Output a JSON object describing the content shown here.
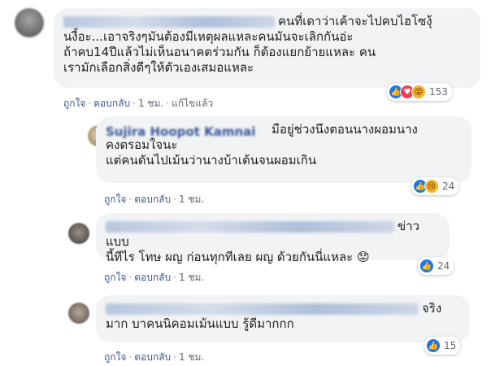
{
  "comments": [
    {
      "text": "คนที่เดาว่าเค้าจะไปคบไฮโซงุ้นงี้อะ...เอาจริงๆมันต้องมีเหตุผลแหละคนมันจะเลิกกันอ่ะ\nถ้าคบ14ปีแล้วไม่เห็นอนาคตร่วมกัน ก็ต้องแยกย้ายแหละ คน\nเรามักเลือกสิ่งดีๆให้ตัวเองเสมอแหละ",
      "actions": {
        "like": "ถูกใจ",
        "reply": "ตอบกลับ",
        "time": "1 ชม.",
        "edited": "แก้ไขแล้ว"
      },
      "reactions": {
        "icons": [
          "like-icon",
          "haha-icon"
        ],
        "count": "153"
      }
    },
    {
      "name": "Sujira Hoopot Kamnai",
      "text": "มือยู่ช่วงนึงตอนนางผอมนาง\nคงตรอมใจนะ\nแต่คนดันไปเม้นว่านางบ้าเต้นจนผอมเกิน",
      "actions": {
        "like": "ถูกใจ",
        "reply": "ตอบกลับ",
        "time": "1 ชม."
      },
      "reactions": {
        "icons": [
          "like-icon",
          "sad-icon"
        ],
        "count": "24"
      }
    },
    {
      "text": "ข่าวแบบ\nนี้ทีไร โทษ ผญ ก่อนทุกทีเลย ผญ ด้วยกันนี่แหละ 😟",
      "actions": {
        "like": "ถูกใจ",
        "reply": "ตอบกลับ",
        "time": "1 ชม."
      },
      "reactions": {
        "icons": [
          "like-icon"
        ],
        "count": "24"
      }
    },
    {
      "text": "จริง\nมาก บาคนนิคอมเม้นแบบ รู้ดีมากกก",
      "actions": {
        "like": "ถูกใจ",
        "reply": "ตอบกลับ",
        "time": "1 ชม."
      },
      "reactions": {
        "icons": [
          "like-icon"
        ],
        "count": "15"
      }
    }
  ],
  "colors": {
    "bubble": "#f2f3f5",
    "link": "#385898",
    "like": "#1877f2"
  }
}
